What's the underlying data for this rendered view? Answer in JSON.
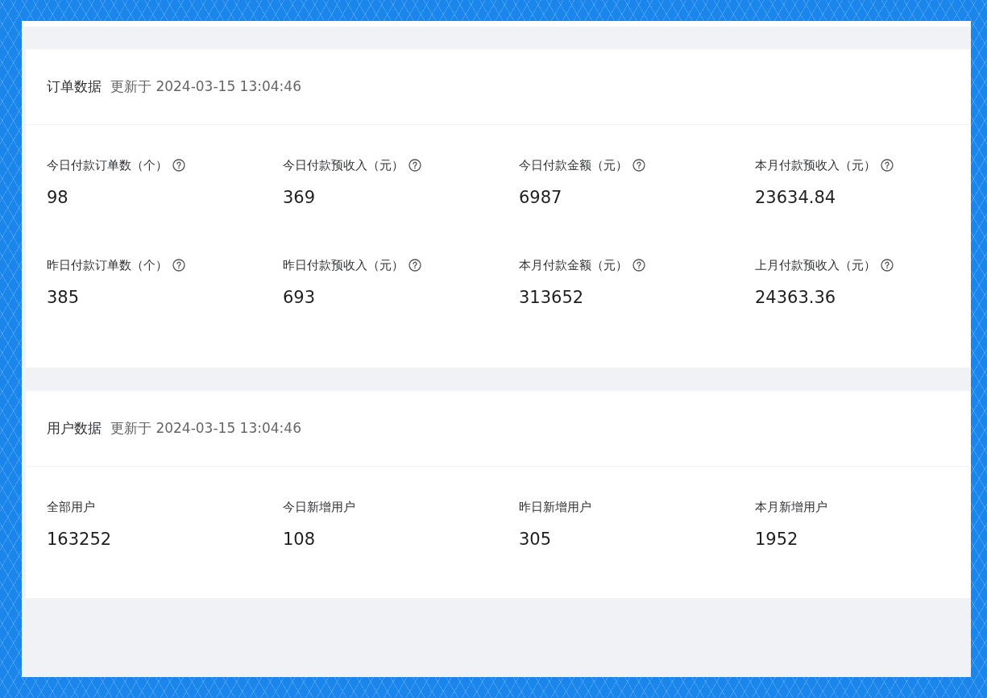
{
  "sections": [
    {
      "title": "订单数据",
      "updated": "更新于 2024-03-15 13:04:46",
      "stats": [
        {
          "label": "今日付款订单数（个）",
          "value": "98",
          "help": true
        },
        {
          "label": "今日付款预收入（元）",
          "value": "369",
          "help": true
        },
        {
          "label": "今日付款金额（元）",
          "value": "6987",
          "help": true
        },
        {
          "label": "本月付款预收入（元）",
          "value": "23634.84",
          "help": true
        },
        {
          "label": "昨日付款订单数（个）",
          "value": "385",
          "help": true
        },
        {
          "label": "昨日付款预收入（元）",
          "value": "693",
          "help": true
        },
        {
          "label": "本月付款金额（元）",
          "value": "313652",
          "help": true
        },
        {
          "label": "上月付款预收入（元）",
          "value": "24363.36",
          "help": true
        }
      ]
    },
    {
      "title": "用户数据",
      "updated": "更新于 2024-03-15 13:04:46",
      "stats": [
        {
          "label": "全部用户",
          "value": "163252"
        },
        {
          "label": "今日新增用户",
          "value": "108"
        },
        {
          "label": "昨日新增用户",
          "value": "305"
        },
        {
          "label": "本月新增用户",
          "value": "1952"
        }
      ]
    }
  ]
}
